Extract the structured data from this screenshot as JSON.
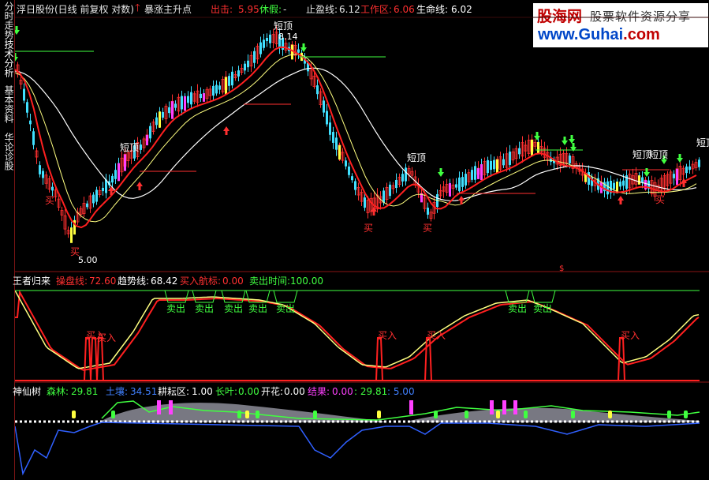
{
  "sidebar": {
    "tabs": [
      {
        "label": "分时走势"
      },
      {
        "label": "技术分析"
      },
      {
        "label": "基本资料"
      },
      {
        "label": "华论诊股"
      }
    ]
  },
  "header": {
    "title": "浮日股份(日线 前复权 对数)",
    "signal": "暴涨主升点",
    "out_label": "出击:",
    "out_value": "5.95",
    "rest_label": "休假:",
    "rest_value": "-",
    "stop_label": "止盈线:",
    "stop_value": "6.12",
    "work_label": "工作区:",
    "work_value": "6.06",
    "life_label": "生命线:",
    "life_value": "6.02"
  },
  "logo": {
    "brand": "股海网",
    "tagline": "股票软件资源分享",
    "url_main": "www.Guhai",
    "url_tld": ".com"
  },
  "main_chart": {
    "labels": {
      "short_top": "短顶",
      "buy": "买",
      "high_price": "8.14",
      "low_price": "5.00",
      "dollar": "$"
    },
    "colors": {
      "up": "#ff3030",
      "down": "#40e0ff",
      "signal_magenta": "#ff40ff",
      "signal_yellow": "#ffff40",
      "ma_white": "#ffffff",
      "ma_yellow": "#ffff80",
      "ma_red": "#ff2020"
    }
  },
  "panel2": {
    "name": "王者归来",
    "trade_label": "操盘线:",
    "trade_value": "72.60",
    "trend_label": "趋势线:",
    "trend_value": "68.42",
    "buy_label": "买入航标:",
    "buy_value": "0.00",
    "sell_label": "卖出时间:",
    "sell_value": "100.00",
    "sell_word": "卖出",
    "buy_word": "买入",
    "bold_buy": "买入"
  },
  "panel3": {
    "name": "神仙树",
    "forest_label": "森林:",
    "forest_value": "29.81",
    "soil_label": "土壤:",
    "soil_value": "34.51",
    "till_label": "耕耘区:",
    "till_value": "1.00",
    "leaf_label": "长叶:",
    "leaf_value": "0.00",
    "flower_label": "开花:",
    "flower_value": "0.00",
    "fruit_label": "结果:",
    "fruit_value": "0.00",
    "extra1": ": 29.81",
    "extra2": ": 5.00"
  }
}
